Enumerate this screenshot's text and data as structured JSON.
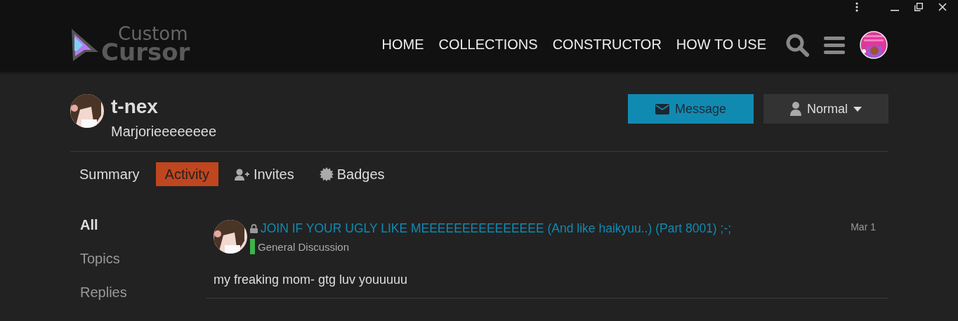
{
  "logo": {
    "line_1": "Custom",
    "line_2": "Cursor"
  },
  "nav": [
    {
      "label": "HOME"
    },
    {
      "label": "COLLECTIONS"
    },
    {
      "label": "CONSTRUCTOR"
    },
    {
      "label": "HOW TO USE"
    }
  ],
  "profile": {
    "username": "t-nex",
    "name": "Marjorieeeeeeee"
  },
  "buttons": [
    {
      "kind": "message",
      "label": "Message"
    },
    {
      "kind": "level",
      "label": "Normal"
    }
  ],
  "tabs": [
    {
      "label": "Summary",
      "selected": false,
      "kind": "plain"
    },
    {
      "label": "Activity",
      "selected": true,
      "kind": "plain"
    },
    {
      "label": "Invites",
      "selected": false,
      "kind": "invites"
    },
    {
      "label": "Badges",
      "selected": false,
      "kind": "badges"
    }
  ],
  "filters": [
    {
      "label": "All",
      "selected": true
    },
    {
      "label": "Topics",
      "selected": false
    },
    {
      "label": "Replies",
      "selected": false
    }
  ],
  "posts": [
    {
      "title": "JOIN IF YOUR UGLY LIKE MEEEEEEEEEEEEEEE (And like haikyuu..) (Part 8001) ;-;",
      "locked": true,
      "category": {
        "name": "General Discussion",
        "color": "#3ab54a"
      },
      "date": "Mar 1",
      "excerpt": "my freaking mom- gtg luv youuuuu"
    }
  ]
}
